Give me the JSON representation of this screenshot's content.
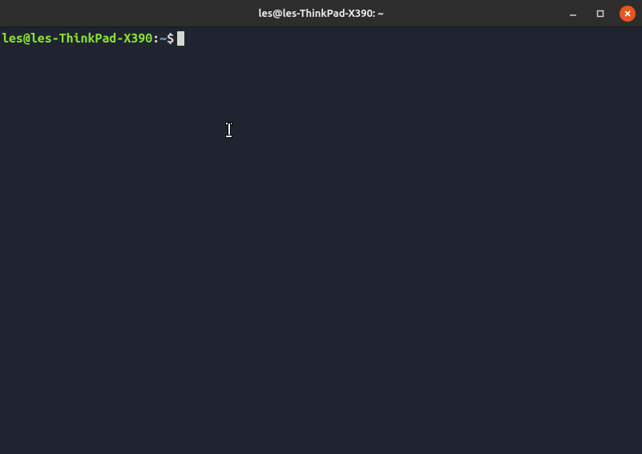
{
  "window": {
    "title": "les@les-ThinkPad-X390: ~"
  },
  "prompt": {
    "user_host": "les@les-ThinkPad-X390",
    "colon": ":",
    "path": "~",
    "dollar": "$"
  },
  "controls": {
    "minimize": "minimize",
    "maximize": "maximize",
    "close": "close"
  }
}
